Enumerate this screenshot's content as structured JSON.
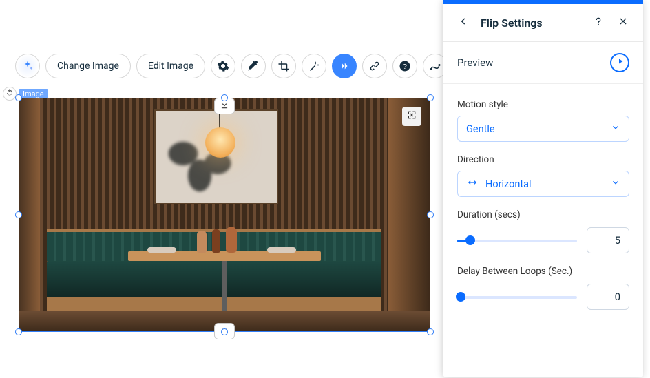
{
  "toolbar": {
    "change_image_label": "Change Image",
    "edit_image_label": "Edit Image"
  },
  "selection": {
    "element_label": "Image"
  },
  "panel": {
    "title": "Flip Settings",
    "preview_label": "Preview",
    "motion_style": {
      "label": "Motion style",
      "value": "Gentle"
    },
    "direction": {
      "label": "Direction",
      "value": "Horizontal"
    },
    "duration": {
      "label": "Duration (secs)",
      "value": "5",
      "percent": 11
    },
    "delay": {
      "label": "Delay Between Loops (Sec.)",
      "value": "0",
      "percent": 0
    }
  }
}
